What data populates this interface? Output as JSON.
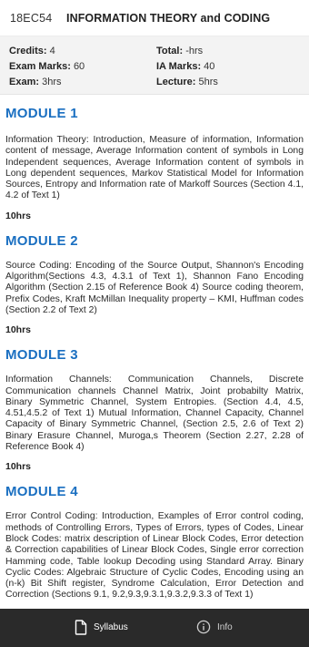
{
  "header": {
    "code": "18EC54",
    "title": "INFORMATION THEORY and CODING"
  },
  "meta": {
    "credits": {
      "label": "Credits:",
      "value": "4"
    },
    "total": {
      "label": "Total:",
      "value": "-hrs"
    },
    "exam_marks": {
      "label": "Exam Marks:",
      "value": "60"
    },
    "ia_marks": {
      "label": "IA Marks:",
      "value": "40"
    },
    "exam": {
      "label": "Exam:",
      "value": "3hrs"
    },
    "lecture": {
      "label": "Lecture:",
      "value": "5hrs"
    }
  },
  "modules": [
    {
      "title": "MODULE 1",
      "body": "Information Theory: Introduction, Measure of information, Information content of message, Average Information content of symbols in Long Independent sequences, Average Information content of symbols in Long dependent sequences, Markov Statistical Model for Information Sources, Entropy and Information rate of Markoff Sources (Section 4.1, 4.2 of Text 1)",
      "hours": "10hrs"
    },
    {
      "title": "MODULE 2",
      "body": "Source Coding: Encoding of the Source Output, Shannon's Encoding Algorithm(Sections 4.3, 4.3.1 of Text 1), Shannon Fano Encoding Algorithm (Section 2.15 of Reference Book 4) Source coding theorem, Prefix Codes, Kraft McMillan Inequality property – KMI, Huffman codes (Section 2.2 of Text 2)",
      "hours": "10hrs"
    },
    {
      "title": "MODULE 3",
      "body": "Information Channels: Communication Channels, Discrete Communication channels Channel Matrix, Joint probabilty Matrix, Binary Symmetric Channel, System Entropies. (Section 4.4, 4.5, 4.51,4.5.2 of Text 1) Mutual Information, Channel Capacity, Channel Capacity of Binary Symmetric Channel, (Section 2.5, 2.6 of Text 2) Binary Erasure Channel, Muroga,s Theorem (Section 2.27, 2.28 of Reference Book 4)",
      "hours": "10hrs"
    },
    {
      "title": "MODULE 4",
      "body": "Error Control Coding: Introduction, Examples of Error control coding, methods of Controlling Errors, Types of Errors, types of Codes, Linear Block Codes: matrix description of Linear Block Codes, Error detection & Correction capabilities of Linear Block Codes, Single error correction Hamming code, Table lookup Decoding using Standard Array. Binary Cyclic Codes: Algebraic Structure of Cyclic Codes, Encoding using an (n-k) Bit Shift register, Syndrome Calculation, Error Detection and Correction (Sections 9.1, 9.2,9.3,9.3.1,9.3.2,9.3.3 of Text 1)",
      "hours": ""
    }
  ],
  "bottom_nav": {
    "syllabus": {
      "label": "Syllabus",
      "icon": "document-icon"
    },
    "info": {
      "label": "Info",
      "icon": "info-icon"
    }
  }
}
